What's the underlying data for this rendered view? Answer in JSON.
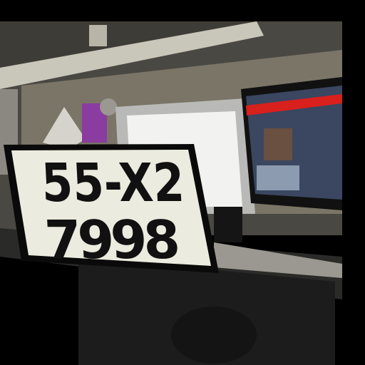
{
  "scene": {
    "description_colors": {
      "wall": "#6e6a60",
      "shelf": "#d8d6cc",
      "monitor_screen": "#f2f2f0",
      "accent_red": "#d8201c",
      "plate_background": "#ecebdf",
      "plate_border": "#0a0a0a"
    }
  },
  "license_plate": {
    "line1": "55-X2",
    "line2": "7998"
  }
}
